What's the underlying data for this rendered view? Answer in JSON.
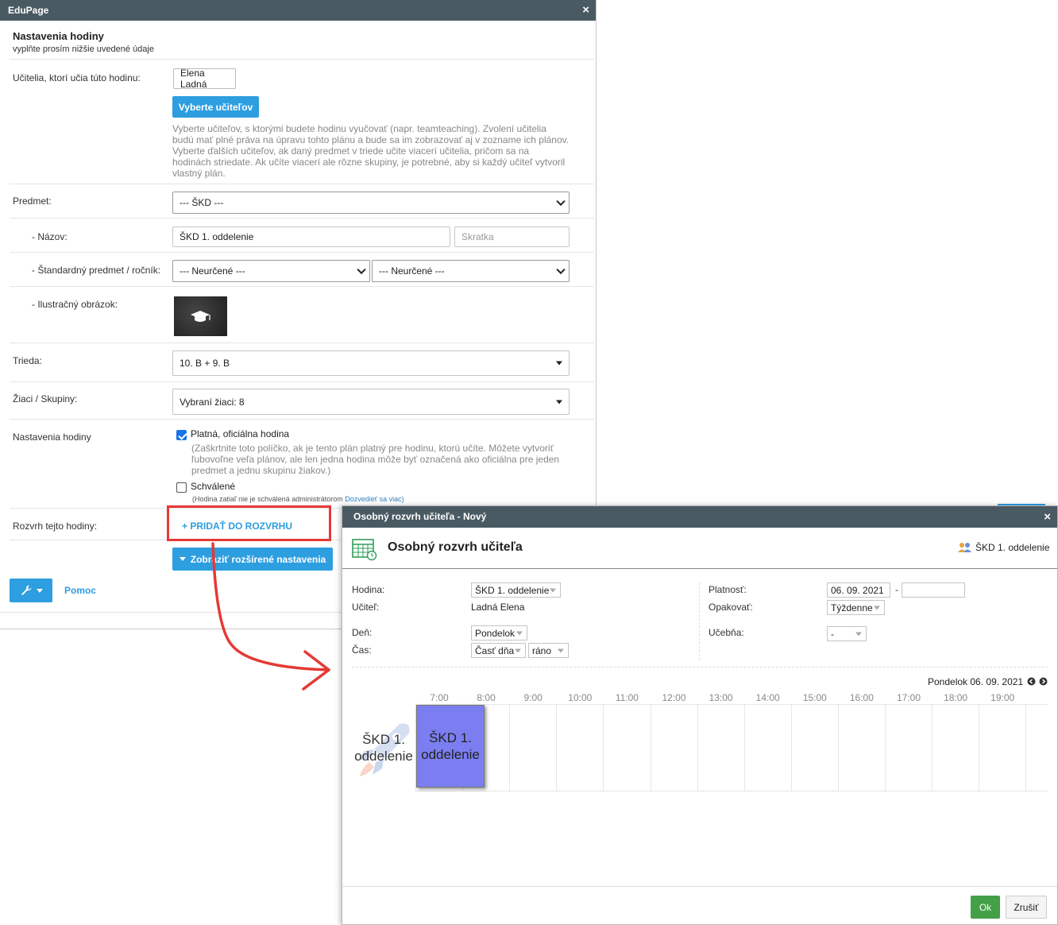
{
  "dialog1": {
    "title": "EduPage",
    "close": "×",
    "heading": "Nastavenia hodiny",
    "subheading": "vyplňte prosím nižšie uvedené údaje",
    "teachers": {
      "label": "Učitelia, ktorí učia túto hodinu:",
      "chip": "Elena Ladná",
      "button": "Vyberte učiteľov",
      "hint_lines": [
        "Vyberte učiteľov, s ktorými budete hodinu vyučovať (napr. teamteaching). Zvolení učitelia",
        "budú mať plné práva na úpravu tohto plánu a bude sa im zobrazovať aj v zozname ich plánov.",
        "Vyberte ďalších učiteľov, ak daný predmet v triede učite viacerí učitelia, pričom sa na",
        "hodinách striedate. Ak učíte viacerí ale rôzne skupiny, je potrebné, aby si každý učiteľ vytvoril",
        "vlastný plán."
      ]
    },
    "subject": {
      "label": "Predmet:",
      "value": "--- ŠKD ---"
    },
    "name": {
      "label": "- Názov:",
      "value": "ŠKD 1. oddelenie",
      "short_placeholder": "Skratka"
    },
    "standard": {
      "label": "- Štandardný predmet / ročník:",
      "subject_value": "--- Neurčené ---",
      "grade_value": "--- Neurčené ---"
    },
    "image": {
      "label": "- Ilustračný obrázok:",
      "icon": "graduation-cap-icon"
    },
    "class": {
      "label": "Trieda:",
      "value": "10. B + 9. B"
    },
    "students": {
      "label": "Žiaci / Skupiny:",
      "value": "Vybraní žiaci: 8"
    },
    "settings": {
      "label": "Nastavenia hodiny",
      "official_label": "Platná, oficiálna hodina",
      "official_checked": true,
      "official_hint_lines": [
        "(Zaškrtnite toto políčko, ak je tento plán platný pre hodinu, ktorú učíte. Môžete vytvoriť",
        "ľubovoľne veľa plánov, ale len jedna hodina môže byť označená ako oficiálna pre jeden",
        "predmet a jednu skupinu žiakov.)"
      ],
      "approved_label": "Schválené",
      "approved_checked": false,
      "approved_hint": "(Hodina zatiaľ nie je schválená administrátorom",
      "approved_link": "Dozvedieť sa viac)"
    },
    "schedule": {
      "label": "Rozvrh tejto hodiny:",
      "add_link": "+ PRIDAŤ DO ROZVRHU"
    },
    "advanced_button": "Zobraziť rozšírené nastavenia",
    "help_link": "Pomoc"
  },
  "dialog2": {
    "title": "Osobný rozvrh učiteľa - Nový",
    "close": "×",
    "heading": "Osobný rozvrh učiteľa",
    "group_chip": "ŠKD 1. oddelenie",
    "form": {
      "hodina_label": "Hodina:",
      "hodina_value": "ŠKD 1. oddelenie",
      "ucitel_label": "Učiteľ:",
      "ucitel_value": "Ladná Elena",
      "den_label": "Deň:",
      "den_value": "Pondelok",
      "cas_label": "Čas:",
      "cas_value": "Časť dňa",
      "cas_part": "ráno",
      "platnost_label": "Platnosť:",
      "platnost_from": "06. 09. 2021",
      "platnost_sep": "-",
      "platnost_to": "",
      "opakovat_label": "Opakovať:",
      "opakovat_value": "Týždenne",
      "ucebna_label": "Učebňa:",
      "ucebna_value": "-"
    },
    "day_header": "Pondelok 06. 09. 2021",
    "hours": [
      "7:00",
      "8:00",
      "9:00",
      "10:00",
      "11:00",
      "12:00",
      "13:00",
      "14:00",
      "15:00",
      "16:00",
      "17:00",
      "18:00",
      "19:00"
    ],
    "row_label_1": "ŠKD 1.",
    "row_label_2": "oddelenie",
    "block_label_1": "ŠKD 1.",
    "block_label_2": "oddelenie",
    "block_color": "#7b7ef0",
    "ok_button": "Ok",
    "cancel_button": "Zrušiť"
  },
  "annotation_color": "#e53935",
  "accent_color": "#2d9ee0"
}
